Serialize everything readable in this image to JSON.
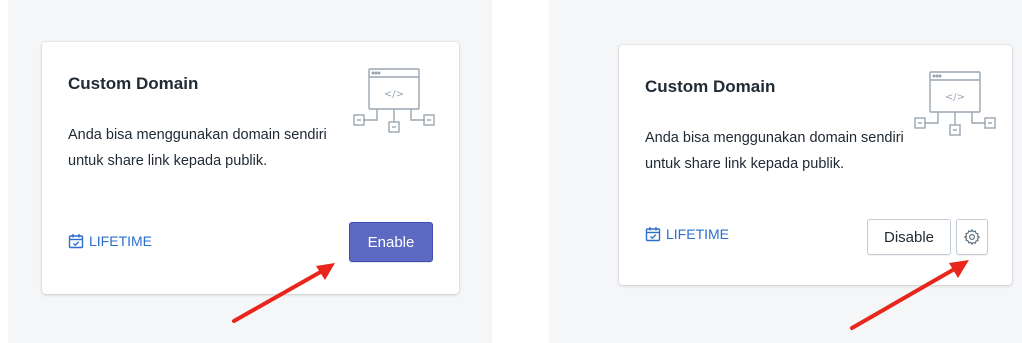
{
  "cards": [
    {
      "title": "Custom Domain",
      "description": "Anda bisa menggunakan domain sendiri untuk share link kepada publik.",
      "badge_label": "LIFETIME",
      "badge_icon": "calendar-check-icon",
      "illustration_icon": "browser-code-network-icon",
      "button_label": "Enable",
      "state": "disabled"
    },
    {
      "title": "Custom Domain",
      "description": "Anda bisa menggunakan domain sendiri untuk share link kepada publik.",
      "badge_label": "LIFETIME",
      "badge_icon": "calendar-check-icon",
      "illustration_icon": "browser-code-network-icon",
      "button_label": "Disable",
      "settings_icon": "gear-icon",
      "state": "enabled"
    }
  ],
  "colors": {
    "primary": "#5c6ac4",
    "link": "#2c6ecb",
    "text": "#212b36",
    "background": "#f4f6f8",
    "arrow": "#e8261c"
  }
}
